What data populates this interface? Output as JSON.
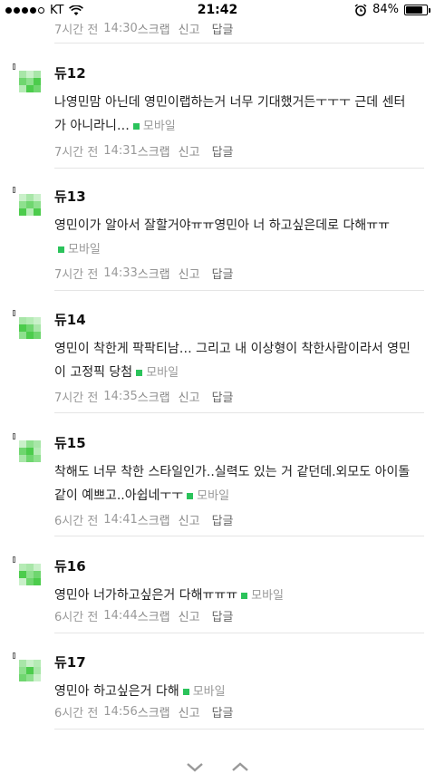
{
  "status": {
    "carrier": "KT",
    "time": "21:42",
    "battery": "84%",
    "battery_level": 0.84
  },
  "top_meta": {
    "time": "7시간 전",
    "clock": "14:30",
    "scrap": "스크랩",
    "report": "신고",
    "reply": "답글"
  },
  "comments": [
    {
      "nick": "듀12",
      "text": "나영민맘 아닌데 영민이랩하는거 너무 기대했거든ㅜㅜㅜ 근데 센터가 아니라니…",
      "mobile": "모바일",
      "time": "7시간 전",
      "clock": "14:31",
      "scrap": "스크랩",
      "report": "신고",
      "reply": "답글"
    },
    {
      "nick": "듀13",
      "text": "영민이가 알아서 잘할거야ㅠㅠ영민아 너 하고싶은데로 다해ㅠㅠ",
      "mobile": "모바일",
      "time": "7시간 전",
      "clock": "14:33",
      "scrap": "스크랩",
      "report": "신고",
      "reply": "답글"
    },
    {
      "nick": "듀14",
      "text": "영민이 착한게 팍팍티남… 그리고 내 이상형이 착한사람이라서 영민이 고정픽 당첨",
      "mobile": "모바일",
      "time": "7시간 전",
      "clock": "14:35",
      "scrap": "스크랩",
      "report": "신고",
      "reply": "답글"
    },
    {
      "nick": "듀15",
      "text": "착해도 너무 착한 스타일인가..실력도 있는 거 같던데.외모도 아이돌 같이 예쁘고..아쉽네ㅜㅜ",
      "mobile": "모바일",
      "time": "6시간 전",
      "clock": "14:41",
      "scrap": "스크랩",
      "report": "신고",
      "reply": "답글"
    },
    {
      "nick": "듀16",
      "text": "영민아 너가하고싶은거 다해ㅠㅠㅠ",
      "mobile": "모바일",
      "time": "6시간 전",
      "clock": "14:44",
      "scrap": "스크랩",
      "report": "신고",
      "reply": "답글"
    },
    {
      "nick": "듀17",
      "text": "영민아 하고싶은거 다해",
      "mobile": "모바일",
      "time": "6시간 전",
      "clock": "14:56",
      "scrap": "스크랩",
      "report": "신고",
      "reply": "답글"
    }
  ],
  "nav": {
    "down_icon": "chevron-down-icon",
    "up_icon": "chevron-up-icon"
  }
}
